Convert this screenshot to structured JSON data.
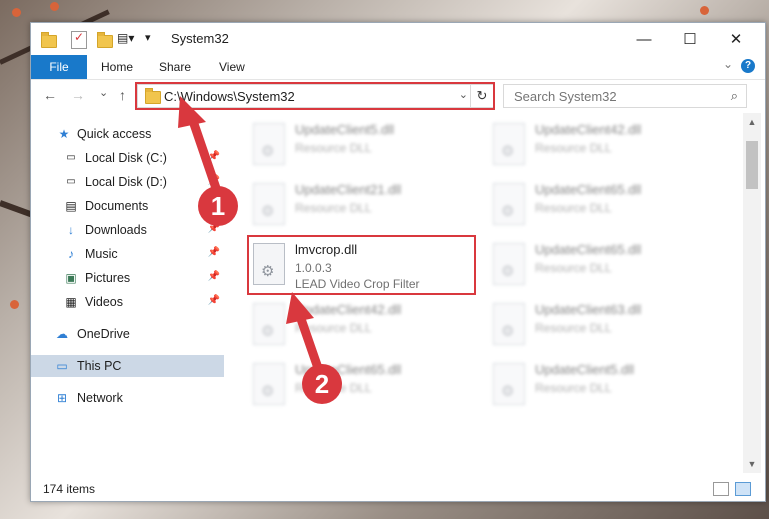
{
  "window": {
    "title": "System32",
    "controls": {
      "minimize": "—",
      "maximize": "☐",
      "close": "✕"
    }
  },
  "ribbon": {
    "tabs": [
      "File",
      "Home",
      "Share",
      "View"
    ],
    "help": "?"
  },
  "navigation": {
    "back": "←",
    "forward": "→",
    "recent": "⌄",
    "up": "↑",
    "address_path": "C:\\Windows\\System32",
    "search_placeholder": "Search System32"
  },
  "sidebar": {
    "items": [
      {
        "label": "Quick access",
        "icon": "star-icon"
      },
      {
        "label": "Local Disk (C:)",
        "icon": "drive-icon",
        "pinned": true
      },
      {
        "label": "Local Disk (D:)",
        "icon": "drive-icon",
        "pinned": true
      },
      {
        "label": "Documents",
        "icon": "documents-icon",
        "pinned": true
      },
      {
        "label": "Downloads",
        "icon": "download-icon",
        "pinned": true
      },
      {
        "label": "Music",
        "icon": "music-icon",
        "pinned": true
      },
      {
        "label": "Pictures",
        "icon": "pictures-icon",
        "pinned": true
      },
      {
        "label": "Videos",
        "icon": "videos-icon",
        "pinned": true
      },
      {
        "label": "OneDrive",
        "icon": "cloud-icon"
      },
      {
        "label": "This PC",
        "icon": "computer-icon",
        "selected": true
      },
      {
        "label": "Network",
        "icon": "network-icon"
      }
    ]
  },
  "files": {
    "left": [
      {
        "name": "UpdateClient5.dll",
        "desc": "Resource DLL"
      },
      {
        "name": "UpdateClient21.dll",
        "desc": "Resource DLL"
      },
      {
        "name": "lmvcrop.dll",
        "version": "1.0.0.3",
        "desc": "LEAD Video Crop Filter"
      },
      {
        "name": "UpdateClient42.dll",
        "desc": "Resource DLL"
      },
      {
        "name": "UpdateClient65.dll",
        "desc": "Resource DLL"
      }
    ],
    "right": [
      {
        "name": "UpdateClient42.dll",
        "desc": "Resource DLL"
      },
      {
        "name": "UpdateClient65.dll",
        "desc": "Resource DLL"
      },
      {
        "name": "UpdateClient65.dll",
        "desc": "Resource DLL"
      },
      {
        "name": "UpdateClient63.dll",
        "desc": "Resource DLL"
      },
      {
        "name": "UpdateClient5.dll",
        "desc": "Resource DLL"
      }
    ]
  },
  "status": {
    "item_count": "174 items"
  },
  "callouts": [
    "1",
    "2"
  ],
  "colors": {
    "accent": "#1979ca",
    "highlight": "#d9383e",
    "selected": "#ccd8e6"
  }
}
